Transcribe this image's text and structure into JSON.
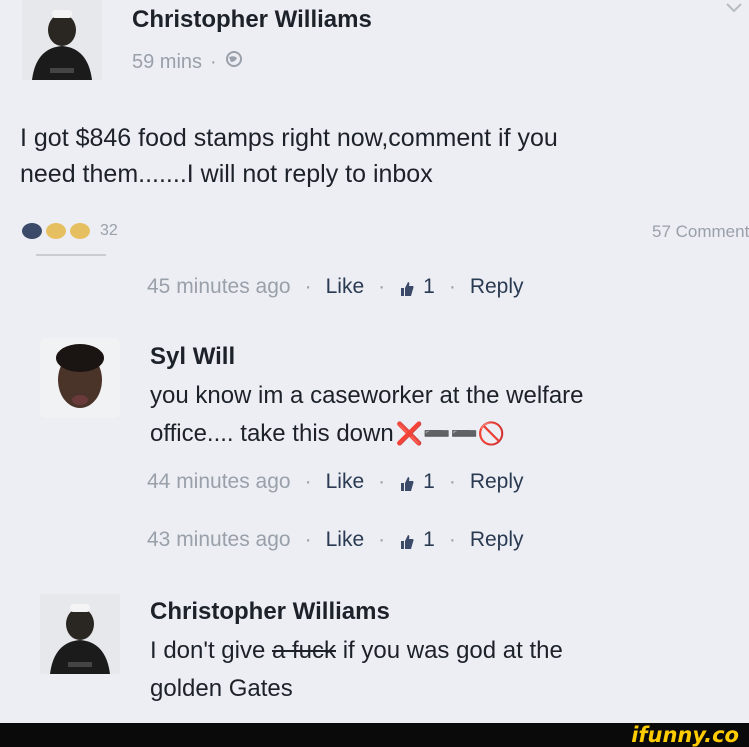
{
  "post": {
    "author": "Christopher Williams",
    "time": "59 mins",
    "dot": "·",
    "text_line1": "I got $846 food stamps right now,comment if you",
    "text_line2": "need them.......I will not reply to inbox",
    "reaction_count": "32",
    "comments_count": "57 Comments"
  },
  "action_row_1": {
    "time": "45 minutes ago",
    "like": "Like",
    "likes": "1",
    "reply": "Reply"
  },
  "comment_syl": {
    "author": "Syl Will",
    "line1": "you know im a caseworker at the welfare",
    "line2": "office.... take this down",
    "emoji": "❌➖➖🚫",
    "time": "44 minutes ago",
    "like": "Like",
    "likes": "1",
    "reply": "Reply"
  },
  "action_row_3": {
    "time": "43 minutes ago",
    "like": "Like",
    "likes": "1",
    "reply": "Reply"
  },
  "comment_chris": {
    "author": "Christopher Williams",
    "line1_a": "I don't give ",
    "line1_strike": "a fuck",
    "line1_b": " if you was god at the",
    "line2": "golden Gates"
  },
  "watermark": "ifunny.co",
  "separator": "·",
  "colors": {
    "background": "#eceef3",
    "muted": "#9aa0aa",
    "text": "#1d2129",
    "brand": "#ffcc00"
  }
}
